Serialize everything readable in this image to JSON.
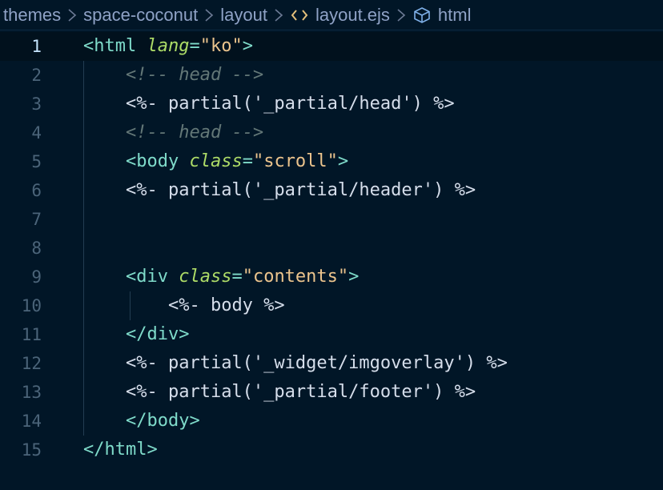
{
  "breadcrumb": {
    "items": [
      "themes",
      "space-coconut",
      "layout",
      "layout.ejs",
      "html"
    ]
  },
  "lines": [
    {
      "n": "1",
      "indent": "",
      "parts": [
        [
          "tag",
          "<html "
        ],
        [
          "attr",
          "lang"
        ],
        [
          "punc",
          "="
        ],
        [
          "str",
          "\"ko\""
        ],
        [
          "tag",
          ">"
        ]
      ]
    },
    {
      "n": "2",
      "indent": "    ",
      "parts": [
        [
          "cmt",
          "<!-- head -->"
        ]
      ]
    },
    {
      "n": "3",
      "indent": "    ",
      "parts": [
        [
          "ejs",
          "<%- partial('_partial/head') %>"
        ]
      ]
    },
    {
      "n": "4",
      "indent": "    ",
      "parts": [
        [
          "cmt",
          "<!-- head -->"
        ]
      ]
    },
    {
      "n": "5",
      "indent": "    ",
      "parts": [
        [
          "tag",
          "<body "
        ],
        [
          "attr",
          "class"
        ],
        [
          "punc",
          "="
        ],
        [
          "str",
          "\"scroll\""
        ],
        [
          "tag",
          ">"
        ]
      ]
    },
    {
      "n": "6",
      "indent": "    ",
      "parts": [
        [
          "ejs",
          "<%- partial('_partial/header') %>"
        ]
      ]
    },
    {
      "n": "7",
      "indent": "",
      "parts": []
    },
    {
      "n": "8",
      "indent": "",
      "parts": []
    },
    {
      "n": "9",
      "indent": "    ",
      "parts": [
        [
          "tag",
          "<div "
        ],
        [
          "attr",
          "class"
        ],
        [
          "punc",
          "="
        ],
        [
          "str",
          "\"contents\""
        ],
        [
          "tag",
          ">"
        ]
      ]
    },
    {
      "n": "10",
      "indent": "        ",
      "parts": [
        [
          "ejs",
          "<%- body %>"
        ]
      ]
    },
    {
      "n": "11",
      "indent": "    ",
      "parts": [
        [
          "tag",
          "</div>"
        ]
      ]
    },
    {
      "n": "12",
      "indent": "    ",
      "parts": [
        [
          "ejs",
          "<%- partial('_widget/imgoverlay') %>"
        ]
      ]
    },
    {
      "n": "13",
      "indent": "    ",
      "parts": [
        [
          "ejs",
          "<%- partial('_partial/footer') %>"
        ]
      ]
    },
    {
      "n": "14",
      "indent": "    ",
      "parts": [
        [
          "tag",
          "</body>"
        ]
      ]
    },
    {
      "n": "15",
      "indent": "",
      "parts": [
        [
          "tag",
          "</html>"
        ]
      ]
    }
  ],
  "active_line": "1",
  "colors": {
    "background": "#011627",
    "tag": "#7fdbca",
    "attribute": "#addb67",
    "string": "#ecc48d",
    "comment": "#637777",
    "text": "#d6deeb",
    "line_number": "#4b6479"
  }
}
